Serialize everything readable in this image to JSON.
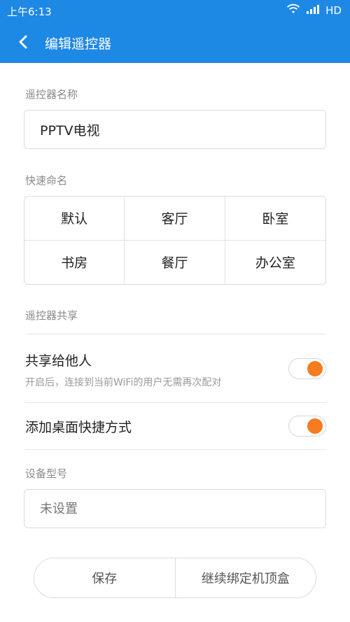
{
  "status_bar": {
    "time": "上午6:13",
    "network": "HD",
    "icons": [
      "wifi-icon",
      "signal-icon"
    ]
  },
  "header": {
    "title": "编辑遥控器",
    "back_icon": "back-chevron-icon",
    "color": "#1e88e5"
  },
  "remote_name": {
    "label": "遥控器名称",
    "value": "PPTV电视"
  },
  "quick_names": {
    "label": "快速命名",
    "items": [
      "默认",
      "客厅",
      "卧室",
      "书房",
      "餐厅",
      "办公室"
    ]
  },
  "sharing": {
    "label": "遥控器共享",
    "share_title": "共享给他人",
    "share_desc": "开启后，连接到当前WiFi的用户无需再次配对",
    "share_on": true,
    "shortcut_title": "添加桌面快捷方式",
    "shortcut_on": true,
    "toggle_color": "#f57c1f"
  },
  "device_model": {
    "label": "设备型号",
    "placeholder": "未设置"
  },
  "actions": {
    "save_label": "保存",
    "continue_label": "继续绑定机顶盒"
  }
}
